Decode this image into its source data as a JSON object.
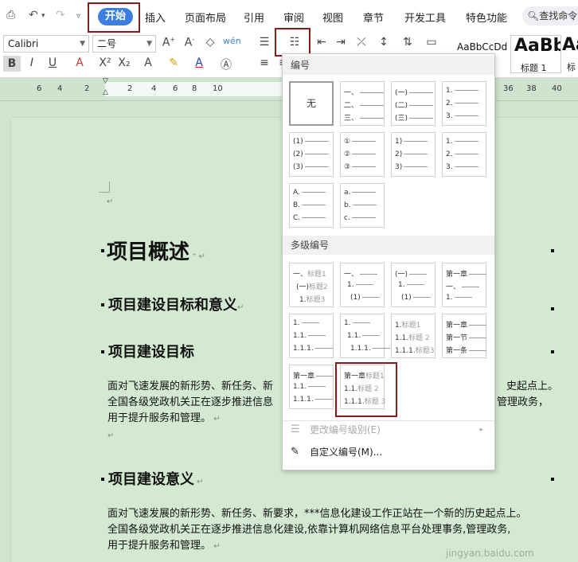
{
  "menubar": {
    "tabs": [
      "开始",
      "插入",
      "页面布局",
      "引用",
      "审阅",
      "视图",
      "章节",
      "开发工具",
      "特色功能"
    ],
    "search_placeholder": "查找命令"
  },
  "ribbon": {
    "font_name": "Calibri",
    "font_size": "二号",
    "styles": [
      {
        "preview": "AaBbCcDd",
        "caption": ""
      },
      {
        "preview": "AaBb",
        "caption": "标题 1"
      },
      {
        "preview": "Aa",
        "caption": "标"
      }
    ]
  },
  "ruler": {
    "numbers": [
      "6",
      "4",
      "2",
      "2",
      "4",
      "6",
      "8",
      "10",
      "36",
      "38",
      "40"
    ]
  },
  "document": {
    "h1": "项目概述",
    "h2a": "项目建设目标和意义",
    "h2b": "项目建设目标",
    "para1": [
      "面对飞速发展的新形势、新任务、新",
      "全国各级党政机关正在逐步推进信息",
      "用于提升服务和管理。"
    ],
    "para1_right": [
      "史起点上。",
      "管理政务，"
    ],
    "h2c": "项目建设意义",
    "para2": [
      "面对飞速发展的新形势、新任务、新要求，***信息化建设工作正站在一个新的历史起点上。",
      "全国各级党政机关正在逐步推进信息化建设,依靠计算机网络信息平台处理事务,管理政务,",
      "用于提升服务和管理。"
    ]
  },
  "numbering_panel": {
    "section1_title": "编号",
    "none_label": "无",
    "single": [
      [
        "一、",
        "二、",
        "三、"
      ],
      [
        "(一)",
        "(二)",
        "(三)"
      ],
      [
        "1.",
        "2.",
        "3."
      ],
      [
        "(1)",
        "(2)",
        "(3)"
      ],
      [
        "①",
        "②",
        "③"
      ],
      [
        "1)",
        "2)",
        "3)"
      ],
      [
        "1.",
        "2.",
        "3."
      ],
      [
        "A.",
        "B.",
        "C."
      ],
      [
        "a.",
        "b.",
        "c."
      ]
    ],
    "section2_title": "多级编号",
    "multi": [
      [
        [
          "一、",
          "标题1"
        ],
        [
          "(一)",
          "标题2"
        ],
        [
          "1.",
          "标题3"
        ]
      ],
      [
        [
          "一、",
          ""
        ],
        [
          "1.",
          ""
        ],
        [
          "(1)",
          ""
        ]
      ],
      [
        [
          "(一)",
          ""
        ],
        [
          "1.",
          ""
        ],
        [
          "(1)",
          ""
        ]
      ],
      [
        [
          "第一章",
          ""
        ],
        [
          "一、",
          ""
        ],
        [
          "1.",
          ""
        ]
      ],
      [
        [
          "1.",
          ""
        ],
        [
          "1.1.",
          ""
        ],
        [
          "1.1.1.",
          ""
        ]
      ],
      [
        [
          "1.",
          ""
        ],
        [
          "1.1.",
          ""
        ],
        [
          "1.1.1.",
          ""
        ]
      ],
      [
        [
          "1.",
          "标题1"
        ],
        [
          "1.1.",
          "标题 2"
        ],
        [
          "1.1.1.",
          "标题3"
        ]
      ],
      [
        [
          "第一章",
          ""
        ],
        [
          "第一节",
          ""
        ],
        [
          "第一条",
          ""
        ]
      ],
      [
        [
          "第一章",
          ""
        ],
        [
          "1.1.",
          ""
        ],
        [
          "1.1.1.",
          ""
        ]
      ],
      [
        [
          "第一章",
          "标题1"
        ],
        [
          "1.1.",
          "标题 2"
        ],
        [
          "1.1.1.",
          "标题 3"
        ]
      ]
    ],
    "change_level": "更改编号级别(E)",
    "custom": "自定义编号(M)..."
  },
  "watermark": "jingyan.baidu.com",
  "colors": {
    "accent": "#3b7fe0",
    "highlight_box": "#8b1a1a",
    "page_bg": "#d3e9d1"
  }
}
